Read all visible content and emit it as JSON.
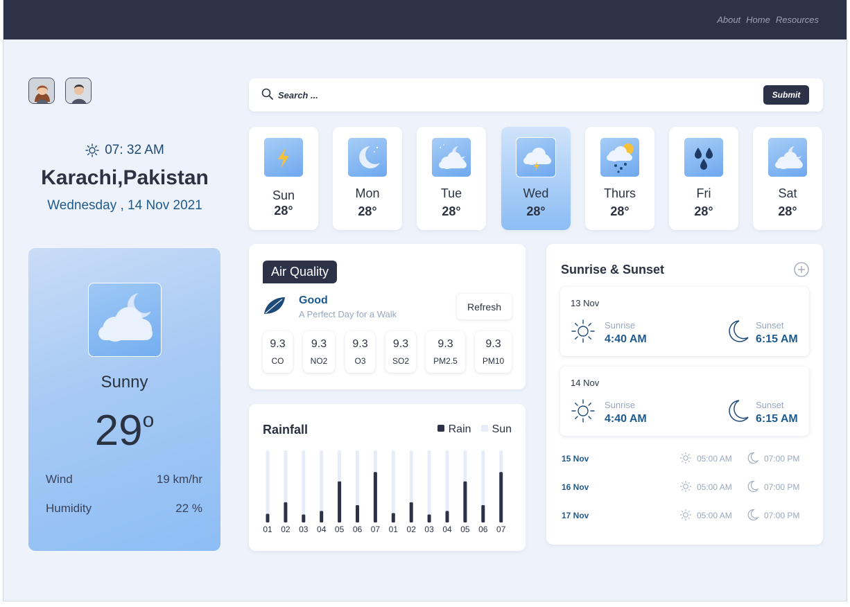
{
  "nav": {
    "links": [
      "About",
      "Home",
      "Resources"
    ]
  },
  "location": {
    "time": "07: 32 AM",
    "city": "Karachi,Pakistan",
    "date": "Wednesday , 14 Nov 2021"
  },
  "current": {
    "condition": "Sunny",
    "temp": "29",
    "temp_unit": "o",
    "wind_label": "Wind",
    "wind_value": "19 km/hr",
    "humidity_label": "Humidity",
    "humidity_value": "22 %"
  },
  "search": {
    "placeholder": "Search ...",
    "submit_label": "Submit"
  },
  "forecast": [
    {
      "day": "Sun",
      "temp": "28°",
      "icon": "lightning-icon"
    },
    {
      "day": "Mon",
      "temp": "28°",
      "icon": "moon-icon"
    },
    {
      "day": "Tue",
      "temp": "28°",
      "icon": "moon-cloud-icon"
    },
    {
      "day": "Wed",
      "temp": "28°",
      "icon": "cloud-lightning-icon",
      "active": true
    },
    {
      "day": "Thurs",
      "temp": "28°",
      "icon": "sun-cloud-rain-icon"
    },
    {
      "day": "Fri",
      "temp": "28°",
      "icon": "raindrops-icon"
    },
    {
      "day": "Sat",
      "temp": "28°",
      "icon": "moon-cloud-icon"
    }
  ],
  "air_quality": {
    "title": "Air Quality",
    "status": "Good",
    "description": "A Perfect Day for a Walk",
    "refresh_label": "Refresh",
    "pollutants": [
      {
        "value": "9.3",
        "name": "CO"
      },
      {
        "value": "9.3",
        "name": "NO2"
      },
      {
        "value": "9.3",
        "name": "O3"
      },
      {
        "value": "9.3",
        "name": "SO2"
      },
      {
        "value": "9.3",
        "name": "PM2.5"
      },
      {
        "value": "9.3",
        "name": "PM10"
      }
    ]
  },
  "rainfall": {
    "title": "Rainfall",
    "legend_rain": "Rain",
    "legend_sun": "Sun"
  },
  "chart_data": {
    "type": "bar",
    "title": "Rainfall",
    "categories": [
      "01",
      "02",
      "03",
      "04",
      "05",
      "06",
      "07",
      "01",
      "02",
      "03",
      "04",
      "05",
      "06",
      "07"
    ],
    "series": [
      {
        "name": "Rain",
        "values": [
          12,
          28,
          11,
          16,
          57,
          24,
          70,
          13,
          28,
          11,
          16,
          57,
          24,
          70
        ]
      },
      {
        "name": "Sun",
        "values": [
          100,
          100,
          100,
          100,
          100,
          100,
          100,
          100,
          100,
          100,
          100,
          100,
          100,
          100
        ]
      }
    ],
    "ylim": [
      0,
      100
    ],
    "colors": {
      "rain": "#2c3247",
      "sun": "#e6edf8"
    }
  },
  "sunrise_sunset": {
    "title": "Sunrise & Sunset",
    "sunrise_label": "Sunrise",
    "sunset_label": "Sunset",
    "detailed": [
      {
        "date": "13 Nov",
        "sunrise": "4:40 AM",
        "sunset": "6:15 AM"
      },
      {
        "date": "14 Nov",
        "sunrise": "4:40 AM",
        "sunset": "6:15 AM"
      }
    ],
    "compact": [
      {
        "date": "15 Nov",
        "sunrise": "05:00 AM",
        "sunset": "07:00 PM"
      },
      {
        "date": "16 Nov",
        "sunrise": "05:00 AM",
        "sunset": "07:00 PM"
      },
      {
        "date": "17 Nov",
        "sunrise": "05:00 AM",
        "sunset": "07:00 PM"
      }
    ]
  },
  "colors": {
    "navbar": "#2c3247",
    "accent_blue": "#1e5a8e",
    "card_gradient_start": "#c9dcf7",
    "card_gradient_end": "#8dbdf5"
  }
}
